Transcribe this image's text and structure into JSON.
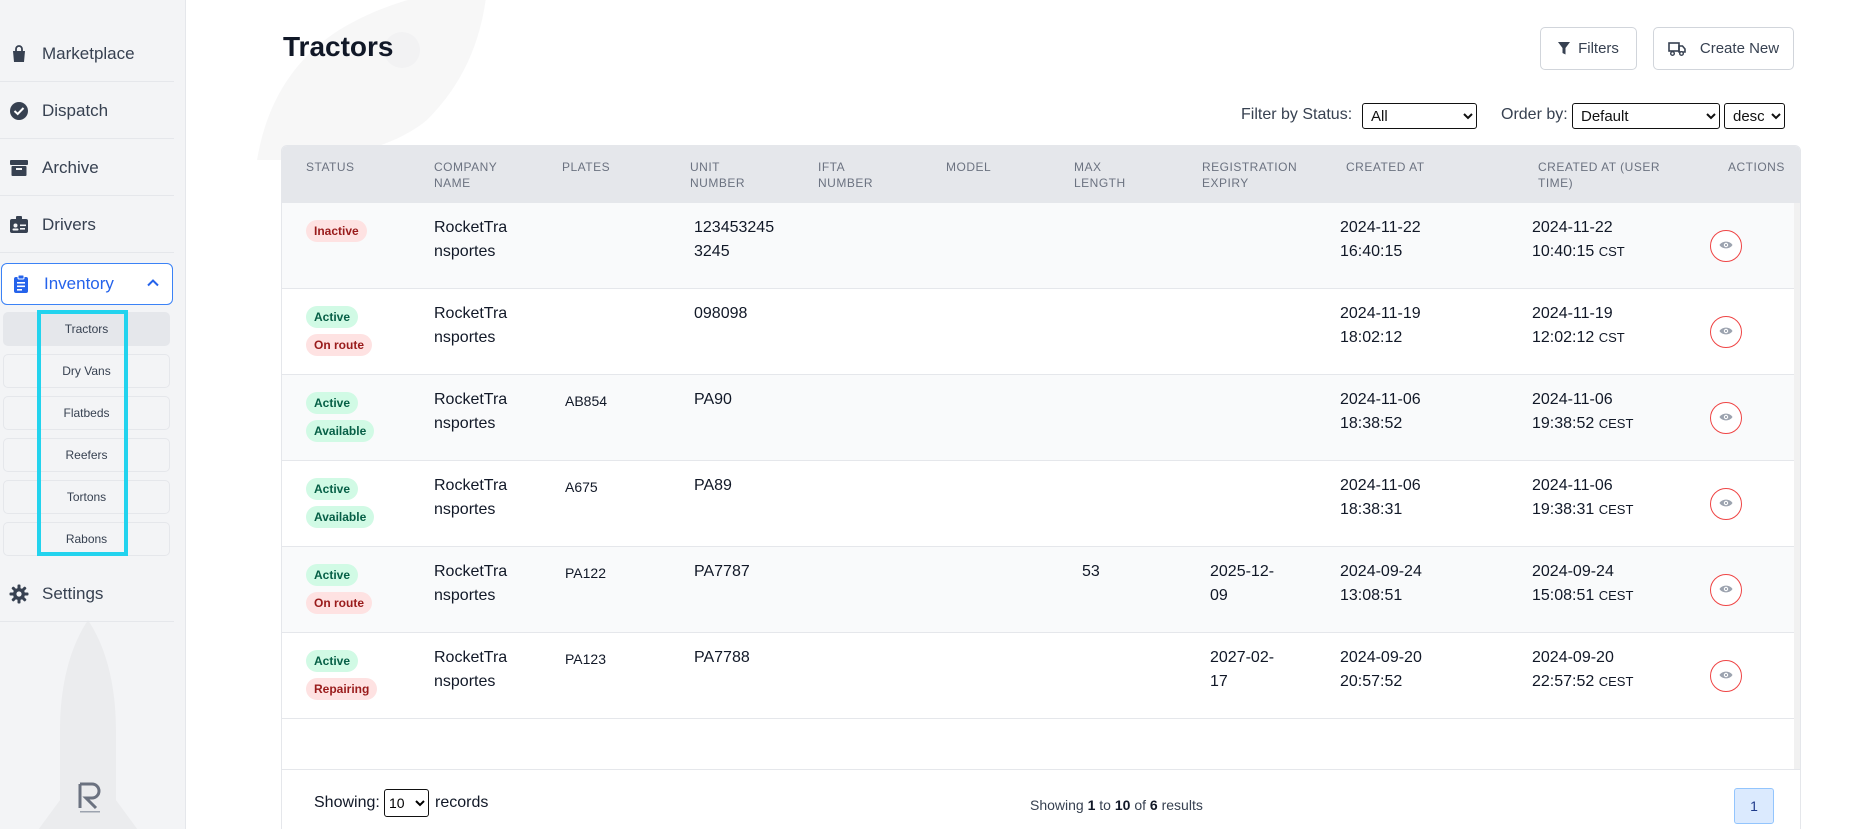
{
  "sidebar": {
    "items": [
      {
        "label": "Marketplace",
        "icon": "shopping-bag-icon"
      },
      {
        "label": "Dispatch",
        "icon": "check-circle-icon"
      },
      {
        "label": "Archive",
        "icon": "archive-box-icon"
      },
      {
        "label": "Drivers",
        "icon": "id-card-icon"
      },
      {
        "label": "Inventory",
        "icon": "clipboard-icon",
        "expanded": true
      },
      {
        "label": "Settings",
        "icon": "gear-icon"
      }
    ],
    "inventory_subitems": [
      "Tractors",
      "Dry Vans",
      "Flatbeds",
      "Reefers",
      "Tortons",
      "Rabons"
    ],
    "current_subitem": "Tractors"
  },
  "page": {
    "title": "Tractors",
    "filters_label": "Filters",
    "create_label": "Create New"
  },
  "controls": {
    "filter_status_label": "Filter by Status:",
    "filter_status_value": "All",
    "order_by_label": "Order by:",
    "order_by_value": "Default",
    "order_dir_value": "desc"
  },
  "table": {
    "columns": [
      "STATUS",
      "COMPANY NAME",
      "PLATES",
      "UNIT NUMBER",
      "IFTA NUMBER",
      "MODEL",
      "MAX LENGTH",
      "REGISTRATION EXPIRY",
      "CREATED AT",
      "CREATED AT (USER TIME)",
      "ACTIONS"
    ],
    "rows": [
      {
        "badges": [
          {
            "text": "Inactive",
            "color": "red"
          }
        ],
        "company": [
          "RocketTra",
          "nsportes"
        ],
        "plates": "",
        "unit": [
          "123453245",
          "3245"
        ],
        "ifta": "",
        "model": "",
        "max_length": "",
        "reg_expiry": [
          "",
          ""
        ],
        "created": [
          "2024-11-22",
          "16:40:15"
        ],
        "created_user": [
          "2024-11-22",
          "10:40:15",
          "CST"
        ]
      },
      {
        "badges": [
          {
            "text": "Active",
            "color": "green"
          },
          {
            "text": "On route",
            "color": "red"
          }
        ],
        "company": [
          "RocketTra",
          "nsportes"
        ],
        "plates": "",
        "unit": [
          "098098",
          ""
        ],
        "ifta": "",
        "model": "",
        "max_length": "",
        "reg_expiry": [
          "",
          ""
        ],
        "created": [
          "2024-11-19",
          "18:02:12"
        ],
        "created_user": [
          "2024-11-19",
          "12:02:12",
          "CST"
        ]
      },
      {
        "badges": [
          {
            "text": "Active",
            "color": "green"
          },
          {
            "text": "Available",
            "color": "green"
          }
        ],
        "company": [
          "RocketTra",
          "nsportes"
        ],
        "plates": "AB854",
        "unit": [
          "PA90",
          ""
        ],
        "ifta": "",
        "model": "",
        "max_length": "",
        "reg_expiry": [
          "",
          ""
        ],
        "created": [
          "2024-11-06",
          "18:38:52"
        ],
        "created_user": [
          "2024-11-06",
          "19:38:52",
          "CEST"
        ]
      },
      {
        "badges": [
          {
            "text": "Active",
            "color": "green"
          },
          {
            "text": "Available",
            "color": "green"
          }
        ],
        "company": [
          "RocketTra",
          "nsportes"
        ],
        "plates": "A675",
        "unit": [
          "PA89",
          ""
        ],
        "ifta": "",
        "model": "",
        "max_length": "",
        "reg_expiry": [
          "",
          ""
        ],
        "created": [
          "2024-11-06",
          "18:38:31"
        ],
        "created_user": [
          "2024-11-06",
          "19:38:31",
          "CEST"
        ]
      },
      {
        "badges": [
          {
            "text": "Active",
            "color": "green"
          },
          {
            "text": "On route",
            "color": "red"
          }
        ],
        "company": [
          "RocketTra",
          "nsportes"
        ],
        "plates": "PA122",
        "unit": [
          "PA7787",
          ""
        ],
        "ifta": "",
        "model": "",
        "max_length": "53",
        "reg_expiry": [
          "2025-12-",
          "09"
        ],
        "created": [
          "2024-09-24",
          "13:08:51"
        ],
        "created_user": [
          "2024-09-24",
          "15:08:51",
          "CEST"
        ]
      },
      {
        "badges": [
          {
            "text": "Active",
            "color": "green"
          },
          {
            "text": "Repairing",
            "color": "red"
          }
        ],
        "company": [
          "RocketTra",
          "nsportes"
        ],
        "plates": "PA123",
        "unit": [
          "PA7788",
          ""
        ],
        "ifta": "",
        "model": "",
        "max_length": "",
        "reg_expiry": [
          "2027-02-",
          "17"
        ],
        "created": [
          "2024-09-20",
          "20:57:52"
        ],
        "created_user": [
          "2024-09-20",
          "22:57:52",
          "CEST"
        ]
      }
    ]
  },
  "footer": {
    "showing_label": "Showing:",
    "page_size": "10",
    "records_label": "records",
    "summary_prefix": "Showing",
    "summary_from": "1",
    "summary_to_label": "to",
    "summary_to": "10",
    "summary_of_label": "of",
    "summary_total": "6",
    "summary_suffix": "results",
    "current_page": "1"
  },
  "colors": {
    "accent": "#2563eb",
    "highlight": "#22d3ee",
    "badge_green_bg": "#d1fae5",
    "badge_red_bg": "#fee2e2",
    "action_ring": "#ef4444"
  }
}
